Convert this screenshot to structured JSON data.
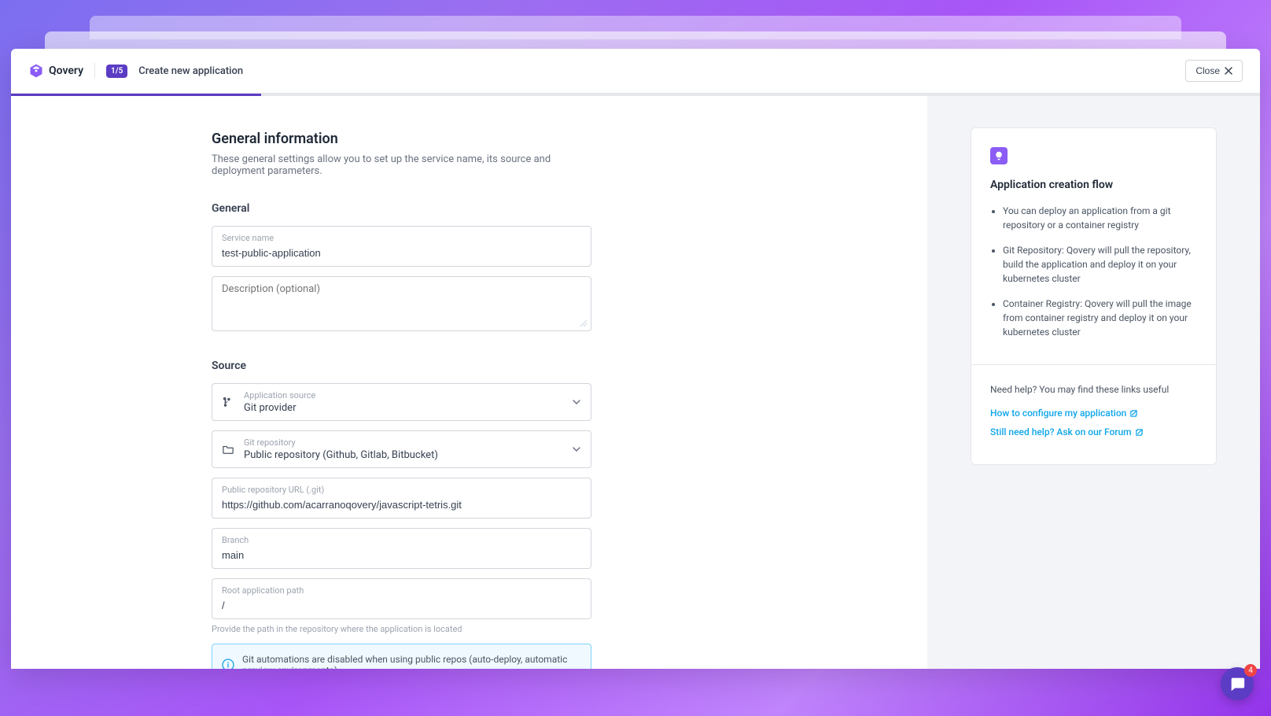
{
  "header": {
    "logo": "Qovery",
    "step": "1/5",
    "title": "Create new application",
    "close": "Close"
  },
  "page": {
    "title": "General information",
    "description": "These general settings allow you to set up the service name, its source and deployment parameters."
  },
  "general": {
    "section_label": "General",
    "service_name_label": "Service name",
    "service_name_value": "test-public-application",
    "desc_placeholder": "Description (optional)"
  },
  "source": {
    "section_label": "Source",
    "app_source_label": "Application source",
    "app_source_value": "Git provider",
    "git_repo_label": "Git repository",
    "git_repo_value": "Public repository (Github, Gitlab, Bitbucket)",
    "repo_url_label": "Public repository URL (.git)",
    "repo_url_value": "https://github.com/acarranoqovery/javascript-tetris.git",
    "branch_label": "Branch",
    "branch_value": "main",
    "root_path_label": "Root application path",
    "root_path_value": "/",
    "root_path_help": "Provide the path in the repository where the application is located",
    "info_message": "Git automations are disabled when using public repos (auto-deploy, automatic preview environments)"
  },
  "tips": {
    "title": "Application creation flow",
    "items": [
      "You can deploy an application from a git repository or a container registry",
      "Git Repository: Qovery will pull the repository, build the application and deploy it on your kubernetes cluster",
      "Container Registry: Qovery will pull the image from container registry and deploy it on your kubernetes cluster"
    ],
    "help_intro": "Need help? You may find these links useful",
    "link1": "How to configure my application",
    "link2": "Still need help? Ask on our Forum"
  },
  "chat": {
    "badge": "4"
  }
}
